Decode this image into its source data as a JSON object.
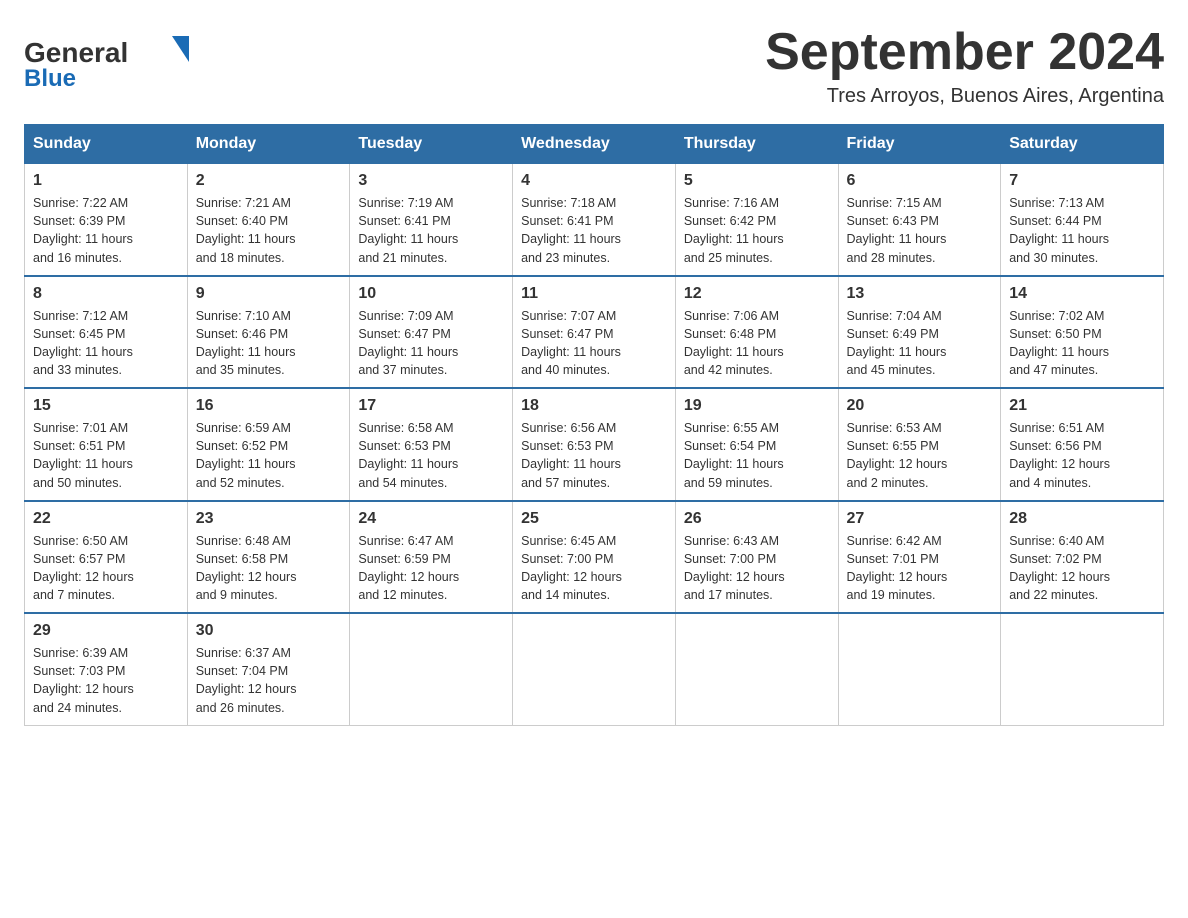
{
  "header": {
    "logo_general": "General",
    "logo_blue": "Blue",
    "month_title": "September 2024",
    "location": "Tres Arroyos, Buenos Aires, Argentina"
  },
  "weekdays": [
    "Sunday",
    "Monday",
    "Tuesday",
    "Wednesday",
    "Thursday",
    "Friday",
    "Saturday"
  ],
  "weeks": [
    [
      {
        "day": "1",
        "sunrise": "7:22 AM",
        "sunset": "6:39 PM",
        "daylight": "11 hours and 16 minutes."
      },
      {
        "day": "2",
        "sunrise": "7:21 AM",
        "sunset": "6:40 PM",
        "daylight": "11 hours and 18 minutes."
      },
      {
        "day": "3",
        "sunrise": "7:19 AM",
        "sunset": "6:41 PM",
        "daylight": "11 hours and 21 minutes."
      },
      {
        "day": "4",
        "sunrise": "7:18 AM",
        "sunset": "6:41 PM",
        "daylight": "11 hours and 23 minutes."
      },
      {
        "day": "5",
        "sunrise": "7:16 AM",
        "sunset": "6:42 PM",
        "daylight": "11 hours and 25 minutes."
      },
      {
        "day": "6",
        "sunrise": "7:15 AM",
        "sunset": "6:43 PM",
        "daylight": "11 hours and 28 minutes."
      },
      {
        "day": "7",
        "sunrise": "7:13 AM",
        "sunset": "6:44 PM",
        "daylight": "11 hours and 30 minutes."
      }
    ],
    [
      {
        "day": "8",
        "sunrise": "7:12 AM",
        "sunset": "6:45 PM",
        "daylight": "11 hours and 33 minutes."
      },
      {
        "day": "9",
        "sunrise": "7:10 AM",
        "sunset": "6:46 PM",
        "daylight": "11 hours and 35 minutes."
      },
      {
        "day": "10",
        "sunrise": "7:09 AM",
        "sunset": "6:47 PM",
        "daylight": "11 hours and 37 minutes."
      },
      {
        "day": "11",
        "sunrise": "7:07 AM",
        "sunset": "6:47 PM",
        "daylight": "11 hours and 40 minutes."
      },
      {
        "day": "12",
        "sunrise": "7:06 AM",
        "sunset": "6:48 PM",
        "daylight": "11 hours and 42 minutes."
      },
      {
        "day": "13",
        "sunrise": "7:04 AM",
        "sunset": "6:49 PM",
        "daylight": "11 hours and 45 minutes."
      },
      {
        "day": "14",
        "sunrise": "7:02 AM",
        "sunset": "6:50 PM",
        "daylight": "11 hours and 47 minutes."
      }
    ],
    [
      {
        "day": "15",
        "sunrise": "7:01 AM",
        "sunset": "6:51 PM",
        "daylight": "11 hours and 50 minutes."
      },
      {
        "day": "16",
        "sunrise": "6:59 AM",
        "sunset": "6:52 PM",
        "daylight": "11 hours and 52 minutes."
      },
      {
        "day": "17",
        "sunrise": "6:58 AM",
        "sunset": "6:53 PM",
        "daylight": "11 hours and 54 minutes."
      },
      {
        "day": "18",
        "sunrise": "6:56 AM",
        "sunset": "6:53 PM",
        "daylight": "11 hours and 57 minutes."
      },
      {
        "day": "19",
        "sunrise": "6:55 AM",
        "sunset": "6:54 PM",
        "daylight": "11 hours and 59 minutes."
      },
      {
        "day": "20",
        "sunrise": "6:53 AM",
        "sunset": "6:55 PM",
        "daylight": "12 hours and 2 minutes."
      },
      {
        "day": "21",
        "sunrise": "6:51 AM",
        "sunset": "6:56 PM",
        "daylight": "12 hours and 4 minutes."
      }
    ],
    [
      {
        "day": "22",
        "sunrise": "6:50 AM",
        "sunset": "6:57 PM",
        "daylight": "12 hours and 7 minutes."
      },
      {
        "day": "23",
        "sunrise": "6:48 AM",
        "sunset": "6:58 PM",
        "daylight": "12 hours and 9 minutes."
      },
      {
        "day": "24",
        "sunrise": "6:47 AM",
        "sunset": "6:59 PM",
        "daylight": "12 hours and 12 minutes."
      },
      {
        "day": "25",
        "sunrise": "6:45 AM",
        "sunset": "7:00 PM",
        "daylight": "12 hours and 14 minutes."
      },
      {
        "day": "26",
        "sunrise": "6:43 AM",
        "sunset": "7:00 PM",
        "daylight": "12 hours and 17 minutes."
      },
      {
        "day": "27",
        "sunrise": "6:42 AM",
        "sunset": "7:01 PM",
        "daylight": "12 hours and 19 minutes."
      },
      {
        "day": "28",
        "sunrise": "6:40 AM",
        "sunset": "7:02 PM",
        "daylight": "12 hours and 22 minutes."
      }
    ],
    [
      {
        "day": "29",
        "sunrise": "6:39 AM",
        "sunset": "7:03 PM",
        "daylight": "12 hours and 24 minutes."
      },
      {
        "day": "30",
        "sunrise": "6:37 AM",
        "sunset": "7:04 PM",
        "daylight": "12 hours and 26 minutes."
      },
      null,
      null,
      null,
      null,
      null
    ]
  ],
  "labels": {
    "sunrise": "Sunrise:",
    "sunset": "Sunset:",
    "daylight": "Daylight:"
  },
  "colors": {
    "header_bg": "#2e6da4",
    "header_text": "#ffffff",
    "accent_blue": "#1a6bb5"
  }
}
